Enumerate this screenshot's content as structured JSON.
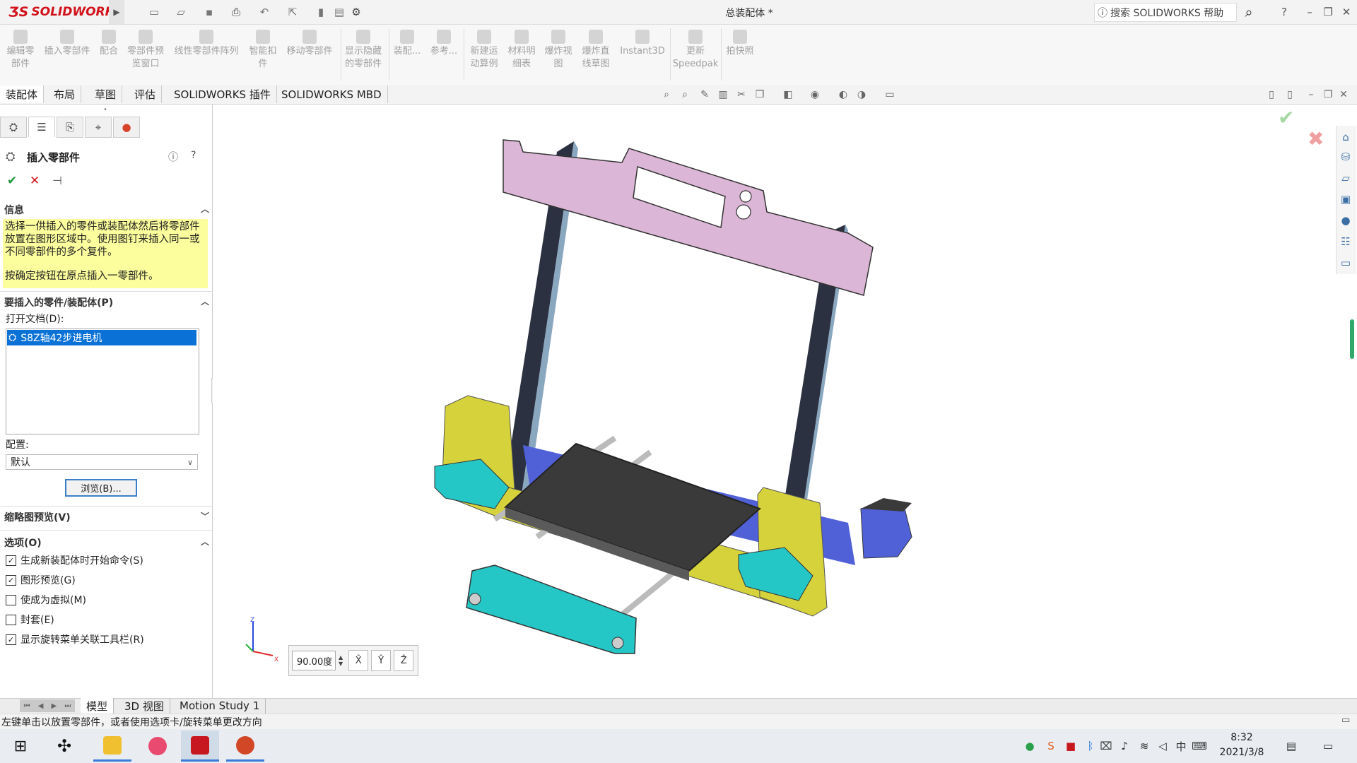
{
  "app": {
    "title": "总装配体 *",
    "search_placeholder": "搜索 SOLIDWORKS 帮助",
    "logo_text": "SOLIDWORKS"
  },
  "commands": [
    {
      "label": "编辑零部件"
    },
    {
      "label": "插入零部件"
    },
    {
      "label": "配合"
    },
    {
      "label": "零部件预览窗口"
    },
    {
      "label": "线性零部件阵列"
    },
    {
      "label": "智能扣件"
    },
    {
      "label": "移动零部件"
    },
    {
      "label": "显示隐藏的零部件"
    },
    {
      "label": "装配..."
    },
    {
      "label": "参考..."
    },
    {
      "label": "新建运动算例"
    },
    {
      "label": "材料明细表"
    },
    {
      "label": "爆炸视图"
    },
    {
      "label": "爆炸直线草图"
    },
    {
      "label": "Instant3D"
    },
    {
      "label": "更新Speedpak"
    },
    {
      "label": "拍快照"
    }
  ],
  "tabs": [
    "装配体",
    "布局",
    "草图",
    "评估",
    "SOLIDWORKS 插件",
    "SOLIDWORKS MBD"
  ],
  "panel": {
    "title": "插入零部件",
    "info_header": "信息",
    "info_text": "选择一供插入的零件或装配体然后将零部件放置在图形区域中。使用图钉来插入同一或不同零部件的多个复件。",
    "info_text2": "按确定按钮在原点插入一零部件。",
    "parts_header": "要插入的零件/装配体(P)",
    "open_docs_label": "打开文档(D):",
    "selected_doc": "S8Z轴42步进电机",
    "config_label": "配置:",
    "config_value": "默认",
    "browse_label": "浏览(B)...",
    "thumb_header": "缩略图预览(V)",
    "options_header": "选项(O)",
    "options": [
      {
        "label": "生成新装配体时开始命令(S)",
        "checked": true
      },
      {
        "label": "图形预览(G)",
        "checked": true
      },
      {
        "label": "使成为虚拟(M)",
        "checked": false
      },
      {
        "label": "封套(E)",
        "checked": false
      },
      {
        "label": "显示旋转菜单关联工具栏(R)",
        "checked": true
      }
    ]
  },
  "rotate": {
    "value": "90.00度"
  },
  "bottom_tabs": [
    "模型",
    "3D 视图",
    "Motion Study 1"
  ],
  "status_text": "左键单击以放置零部件，或者使用选项卡/旋转菜单更改方向",
  "clock": {
    "time": "8:32",
    "date": "2021/3/8"
  },
  "colors": {
    "pink": "#dcb6d6",
    "yellow": "#d6d23b",
    "teal": "#25c6c6",
    "frame": "#2b3140",
    "bed": "#3a3a3a",
    "motor": "#5061d8",
    "highlight": "#0a72d6",
    "info_bg": "#fcfd9c"
  }
}
